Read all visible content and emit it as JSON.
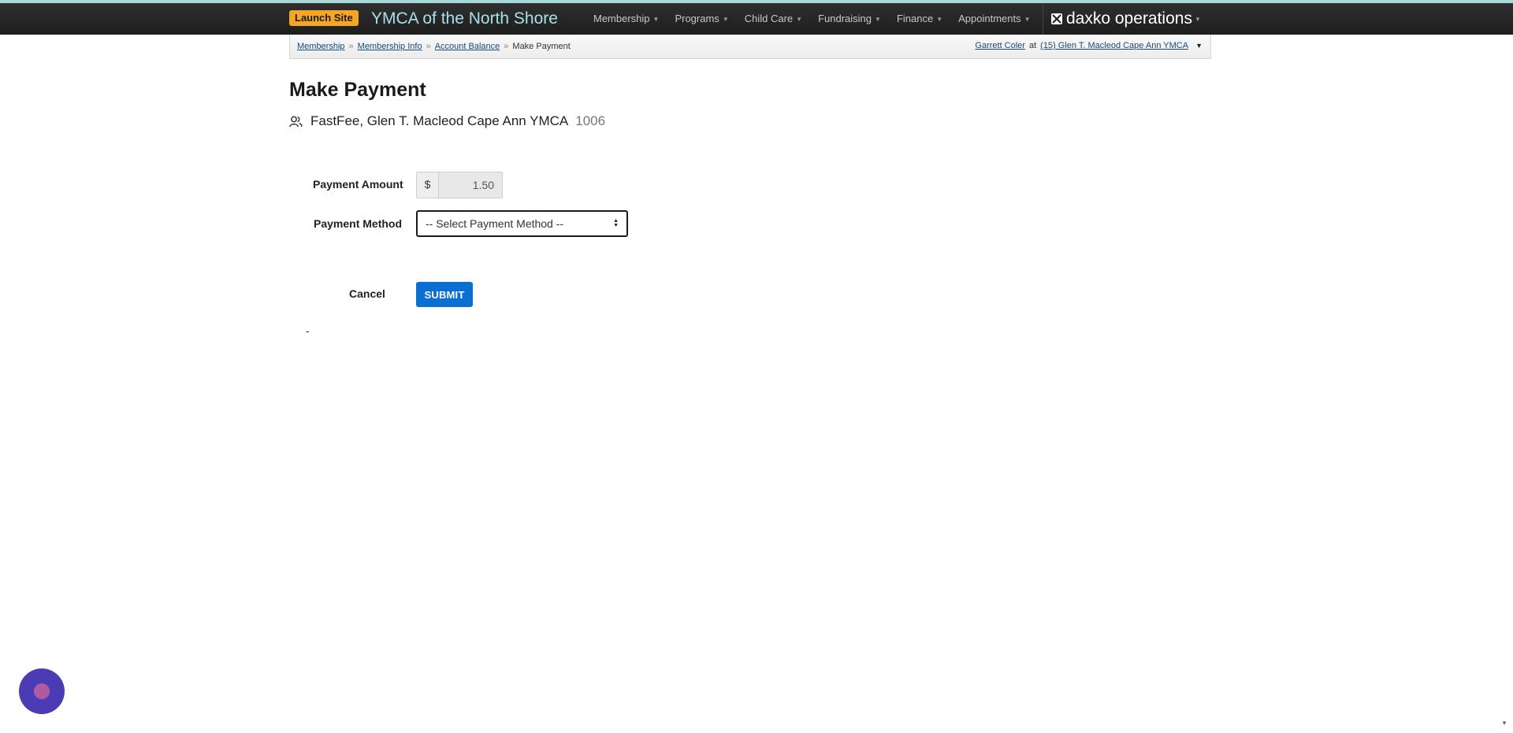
{
  "header": {
    "launch_label": "Launch Site",
    "org_name": "YMCA of the North Shore",
    "nav": [
      "Membership",
      "Programs",
      "Child Care",
      "Fundraising",
      "Finance",
      "Appointments"
    ],
    "brand": "daxko operations"
  },
  "breadcrumb": {
    "items": [
      "Membership",
      "Membership Info",
      "Account Balance"
    ],
    "current": "Make Payment",
    "separator": "»"
  },
  "user": {
    "name": "Garrett Coler",
    "at": "at",
    "location": "(15) Glen T. Macleod Cape Ann YMCA"
  },
  "page": {
    "title": "Make Payment",
    "member_name": "FastFee, Glen T. Macleod Cape Ann YMCA",
    "member_id": "1006"
  },
  "form": {
    "amount_label": "Payment Amount",
    "currency_symbol": "$",
    "amount_value": "1.50",
    "method_label": "Payment Method",
    "method_selected": "-- Select Payment Method --",
    "cancel_label": "Cancel",
    "submit_label": "SUBMIT"
  },
  "footer_text": "-",
  "colors": {
    "topbar": "#1e1e1e",
    "accent": "#a9d8d4",
    "launch": "#f5a623",
    "submit": "#0a6fd1",
    "chat": "#4b3bb5"
  }
}
